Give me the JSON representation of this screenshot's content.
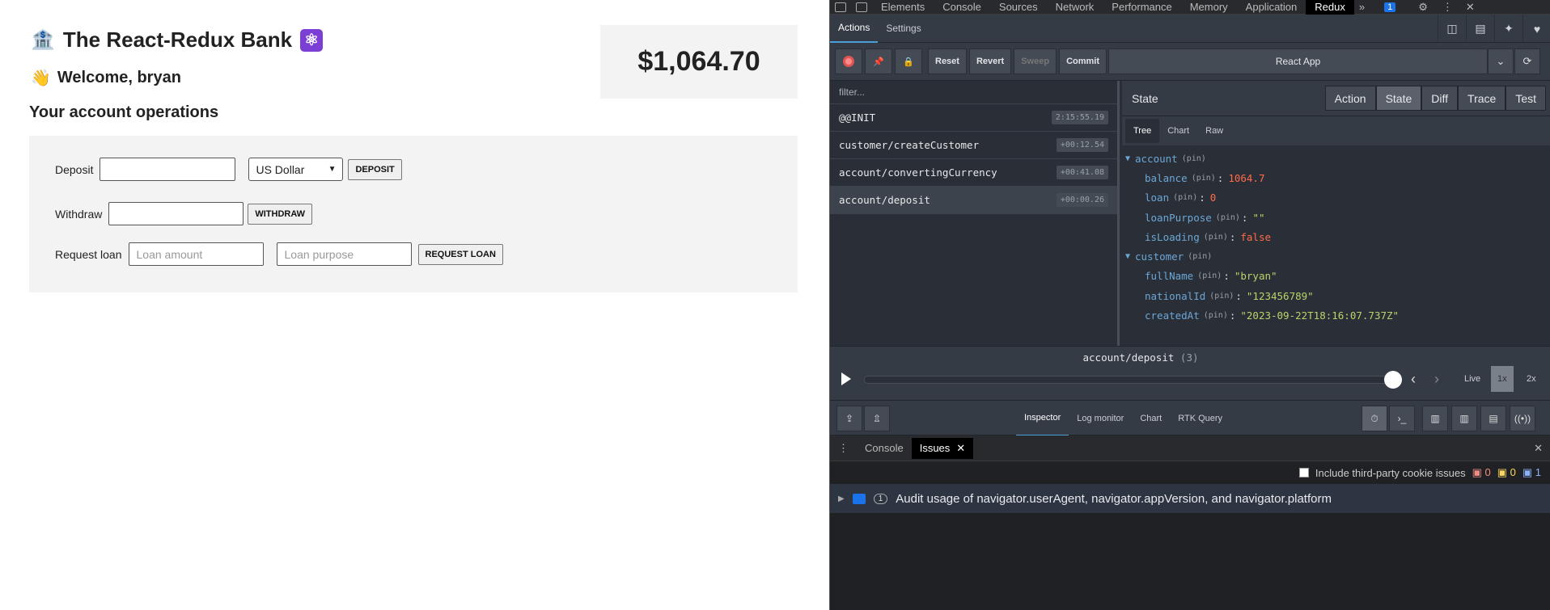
{
  "bank": {
    "title": "The React-Redux Bank",
    "title_icon": "bank-icon",
    "atom_icon": "react-atom-icon",
    "welcome": "Welcome, bryan",
    "welcome_icon": "waving-hand-icon",
    "operations_title": "Your account operations",
    "balance": "$1,064.70",
    "deposit_label": "Deposit",
    "currency_selected": "US Dollar",
    "deposit_button": "DEPOSIT",
    "withdraw_label": "Withdraw",
    "withdraw_button": "WITHDRAW",
    "loan_label": "Request loan",
    "loan_amount_placeholder": "Loan amount",
    "loan_purpose_placeholder": "Loan purpose",
    "loan_button": "REQUEST LOAN"
  },
  "devtools": {
    "tabs": [
      "Elements",
      "Console",
      "Sources",
      "Network",
      "Performance",
      "Memory",
      "Application",
      "Redux"
    ],
    "active_tab": "Redux",
    "issue_badge": "1",
    "redux_tabs": [
      "Actions",
      "Settings"
    ],
    "toolbar": {
      "reset": "Reset",
      "revert": "Revert",
      "sweep": "Sweep",
      "commit": "Commit",
      "instance": "React App"
    },
    "filter_placeholder": "filter...",
    "actions": [
      {
        "name": "@@INIT",
        "time": "2:15:55.19"
      },
      {
        "name": "customer/createCustomer",
        "time": "+00:12.54"
      },
      {
        "name": "account/convertingCurrency",
        "time": "+00:41.08"
      },
      {
        "name": "account/deposit",
        "time": "+00:00.26"
      }
    ],
    "state_title": "State",
    "modes": [
      "Action",
      "State",
      "Diff",
      "Trace",
      "Test"
    ],
    "subtabs": [
      "Tree",
      "Chart",
      "Raw"
    ],
    "pin": "(pin)",
    "tree": {
      "account": "account",
      "balance_key": "balance",
      "balance_val": "1064.7",
      "loan_key": "loan",
      "loan_val": "0",
      "loanPurpose_key": "loanPurpose",
      "loanPurpose_val": "\"\"",
      "isLoading_key": "isLoading",
      "isLoading_val": "false",
      "customer": "customer",
      "fullName_key": "fullName",
      "fullName_val": "\"bryan\"",
      "nationalId_key": "nationalId",
      "nationalId_val": "\"123456789\"",
      "createdAt_key": "createdAt",
      "createdAt_val": "\"2023-09-22T18:16:07.737Z\""
    },
    "slider": {
      "action": "account/deposit",
      "index": "(3)",
      "live": "Live",
      "speed1": "1x",
      "speed2": "2x",
      "position": 1.0
    },
    "monitors": [
      "Inspector",
      "Log monitor",
      "Chart",
      "RTK Query"
    ],
    "drawer_tabs": [
      "Console",
      "Issues"
    ],
    "cookie_label": "Include third-party cookie issues",
    "issue_counts": {
      "errors": "0",
      "warnings": "0",
      "info": "1"
    },
    "issue_row": {
      "count": "1",
      "text": "Audit usage of navigator.userAgent, navigator.appVersion, and navigator.platform"
    }
  }
}
